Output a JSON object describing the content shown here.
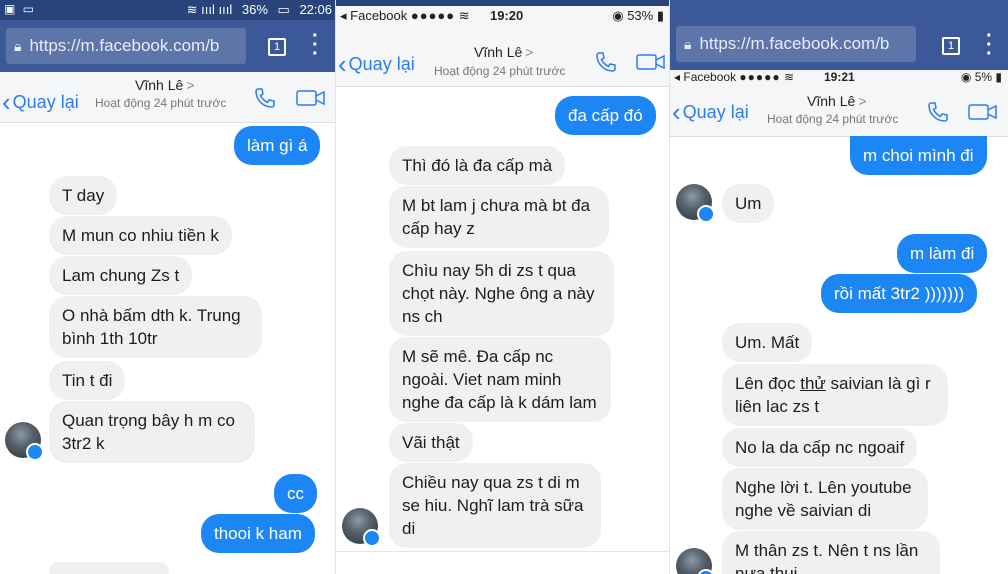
{
  "colors": {
    "messenger_blue": "#1d86f5",
    "facebook_blue": "#3b5998",
    "incoming_bubble": "#f1f0f0"
  },
  "panel1": {
    "status": {
      "time": "22:06",
      "battery": "36%",
      "signal_icons": "signal-icons"
    },
    "url": "https://m.facebook.com/b",
    "tab_count": "1",
    "header": {
      "back": "Quay lại",
      "name": "Vĩnh Lê",
      "status": "Hoạt động 24 phút trước"
    },
    "messages": [
      {
        "dir": "out",
        "text": "làm gì á"
      },
      {
        "dir": "in",
        "text": "T day"
      },
      {
        "dir": "in",
        "text": "M mun co nhiu tiền k"
      },
      {
        "dir": "in",
        "text": "Lam chung Zs t"
      },
      {
        "dir": "in",
        "text": "O nhà bấm dth k. Trung bình 1th 10tr"
      },
      {
        "dir": "in",
        "text": "Tin t đi"
      },
      {
        "dir": "in",
        "text": "Quan trọng bây h m co 3tr2 k"
      },
      {
        "dir": "out",
        "text": "cc"
      },
      {
        "dir": "out",
        "text": "thooi k ham"
      }
    ]
  },
  "panel2": {
    "status": {
      "carrier": "Facebook",
      "signal": "●●●●●",
      "time": "19:20",
      "battery": "53%"
    },
    "header": {
      "back": "Quay lại",
      "name": "Vĩnh Lê",
      "status": "Hoạt động 24 phút trước"
    },
    "messages": [
      {
        "dir": "out",
        "text": "đa cấp đó"
      },
      {
        "dir": "in",
        "text": "Thì đó là đa cấp mà"
      },
      {
        "dir": "in",
        "text": "M bt lam j chưa mà bt đa cấp hay z"
      },
      {
        "dir": "in",
        "text": "Chìu nay 5h di zs t qua chọt này. Nghe ông a này ns ch"
      },
      {
        "dir": "in",
        "text": "M sẽ mê. Đa cấp nc ngoài. Viet nam minh nghe đa cấp là k dám lam"
      },
      {
        "dir": "in",
        "text": "Vãi thật"
      },
      {
        "dir": "in",
        "text": "Chiều nay qua zs t di m se hiu. Nghĩ lam trà sữa di"
      }
    ]
  },
  "panel3": {
    "url": "https://m.facebook.com/b",
    "tab_count": "1",
    "status": {
      "carrier": "Facebook",
      "signal": "●●●●●",
      "time": "19:21",
      "battery": "5%"
    },
    "header": {
      "back": "Quay lại",
      "name": "Vĩnh Lê",
      "status": "Hoạt động 24 phút trước"
    },
    "messages": [
      {
        "dir": "out",
        "text": "m choi mình đi"
      },
      {
        "dir": "in",
        "text": "Um"
      },
      {
        "dir": "out",
        "text": "m làm đi"
      },
      {
        "dir": "out",
        "text": "rồi mất 3tr2 )))))))"
      },
      {
        "dir": "in",
        "text": "Um. Mất"
      },
      {
        "dir": "in",
        "text_a": "Lên đọc ",
        "text_u": "thử",
        "text_b": " saivian là gì r liên lac zs t"
      },
      {
        "dir": "in",
        "text": "No la da cấp nc ngoaif"
      },
      {
        "dir": "in",
        "text": "Nghe lời t. Lên youtube nghe về saivian di"
      },
      {
        "dir": "in",
        "text": "M thân zs t. Nên t ns lần nựa thui"
      }
    ]
  }
}
